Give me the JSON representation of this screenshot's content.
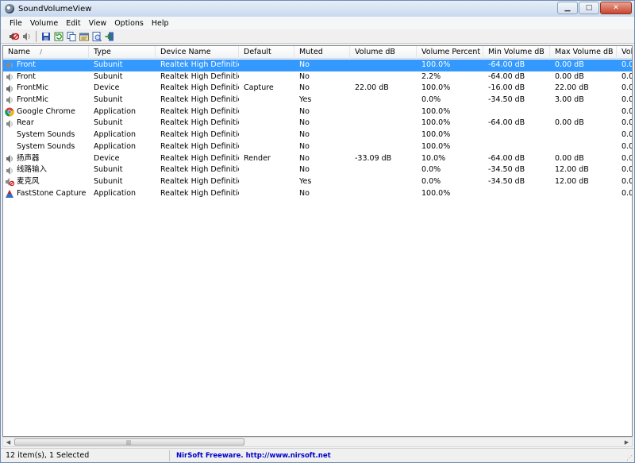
{
  "window": {
    "title": "SoundVolumeView"
  },
  "menu": [
    "File",
    "Volume",
    "Edit",
    "View",
    "Options",
    "Help"
  ],
  "toolbar": {
    "buttons": [
      "mute-icon",
      "speaker-icon",
      "save-icon",
      "refresh-icon",
      "copy-icon",
      "properties-icon",
      "html-report-icon",
      "exit-icon"
    ]
  },
  "columns": [
    "Name",
    "Type",
    "Device Name",
    "Default",
    "Muted",
    "Volume dB",
    "Volume Percent",
    "Min Volume dB",
    "Max Volume dB",
    "Vol"
  ],
  "rows": [
    {
      "name": "Front",
      "type": "Subunit",
      "device": "Realtek High Definitio...",
      "default": "",
      "muted": "No",
      "vol_db": "",
      "vol_pct": "100.0%",
      "min_db": "-64.00 dB",
      "max_db": "0.00 dB",
      "vol": "0.0",
      "icon": "subunit"
    },
    {
      "name": "Front",
      "type": "Subunit",
      "device": "Realtek High Definitio...",
      "default": "",
      "muted": "No",
      "vol_db": "",
      "vol_pct": "2.2%",
      "min_db": "-64.00 dB",
      "max_db": "0.00 dB",
      "vol": "0.0",
      "icon": "subunit"
    },
    {
      "name": "FrontMic",
      "type": "Device",
      "device": "Realtek High Definitio...",
      "default": "Capture",
      "muted": "No",
      "vol_db": "22.00 dB",
      "vol_pct": "100.0%",
      "min_db": "-16.00 dB",
      "max_db": "22.00 dB",
      "vol": "0.0",
      "icon": "device"
    },
    {
      "name": "FrontMic",
      "type": "Subunit",
      "device": "Realtek High Definitio...",
      "default": "",
      "muted": "Yes",
      "vol_db": "",
      "vol_pct": "0.0%",
      "min_db": "-34.50 dB",
      "max_db": "3.00 dB",
      "vol": "0.0",
      "icon": "subunit"
    },
    {
      "name": "Google Chrome",
      "type": "Application",
      "device": "Realtek High Definitio...",
      "default": "",
      "muted": "No",
      "vol_db": "",
      "vol_pct": "100.0%",
      "min_db": "",
      "max_db": "",
      "vol": "0.0",
      "icon": "chrome"
    },
    {
      "name": "Rear",
      "type": "Subunit",
      "device": "Realtek High Definitio...",
      "default": "",
      "muted": "No",
      "vol_db": "",
      "vol_pct": "100.0%",
      "min_db": "-64.00 dB",
      "max_db": "0.00 dB",
      "vol": "0.0",
      "icon": "subunit"
    },
    {
      "name": "System Sounds",
      "type": "Application",
      "device": "Realtek High Definitio...",
      "default": "",
      "muted": "No",
      "vol_db": "",
      "vol_pct": "100.0%",
      "min_db": "",
      "max_db": "",
      "vol": "0.0",
      "icon": "blank"
    },
    {
      "name": "System Sounds",
      "type": "Application",
      "device": "Realtek High Definitio...",
      "default": "",
      "muted": "No",
      "vol_db": "",
      "vol_pct": "100.0%",
      "min_db": "",
      "max_db": "",
      "vol": "0.0",
      "icon": "blank"
    },
    {
      "name": "扬声器",
      "type": "Device",
      "device": "Realtek High Definitio...",
      "default": "Render",
      "muted": "No",
      "vol_db": "-33.09 dB",
      "vol_pct": "10.0%",
      "min_db": "-64.00 dB",
      "max_db": "0.00 dB",
      "vol": "0.0",
      "icon": "device"
    },
    {
      "name": "线路输入",
      "type": "Subunit",
      "device": "Realtek High Definitio...",
      "default": "",
      "muted": "No",
      "vol_db": "",
      "vol_pct": "0.0%",
      "min_db": "-34.50 dB",
      "max_db": "12.00 dB",
      "vol": "0.0",
      "icon": "subunit"
    },
    {
      "name": "麦克风",
      "type": "Subunit",
      "device": "Realtek High Definitio...",
      "default": "",
      "muted": "Yes",
      "vol_db": "",
      "vol_pct": "0.0%",
      "min_db": "-34.50 dB",
      "max_db": "12.00 dB",
      "vol": "0.0",
      "icon": "muted"
    },
    {
      "name": "FastStone Capture",
      "type": "Application",
      "device": "Realtek High Definitio...",
      "default": "",
      "muted": "No",
      "vol_db": "",
      "vol_pct": "100.0%",
      "min_db": "",
      "max_db": "",
      "vol": "0.0",
      "icon": "faststone"
    }
  ],
  "selected_row": 0,
  "status": {
    "summary": "12 item(s), 1 Selected",
    "link": "NirSoft Freeware.  http://www.nirsoft.net"
  }
}
